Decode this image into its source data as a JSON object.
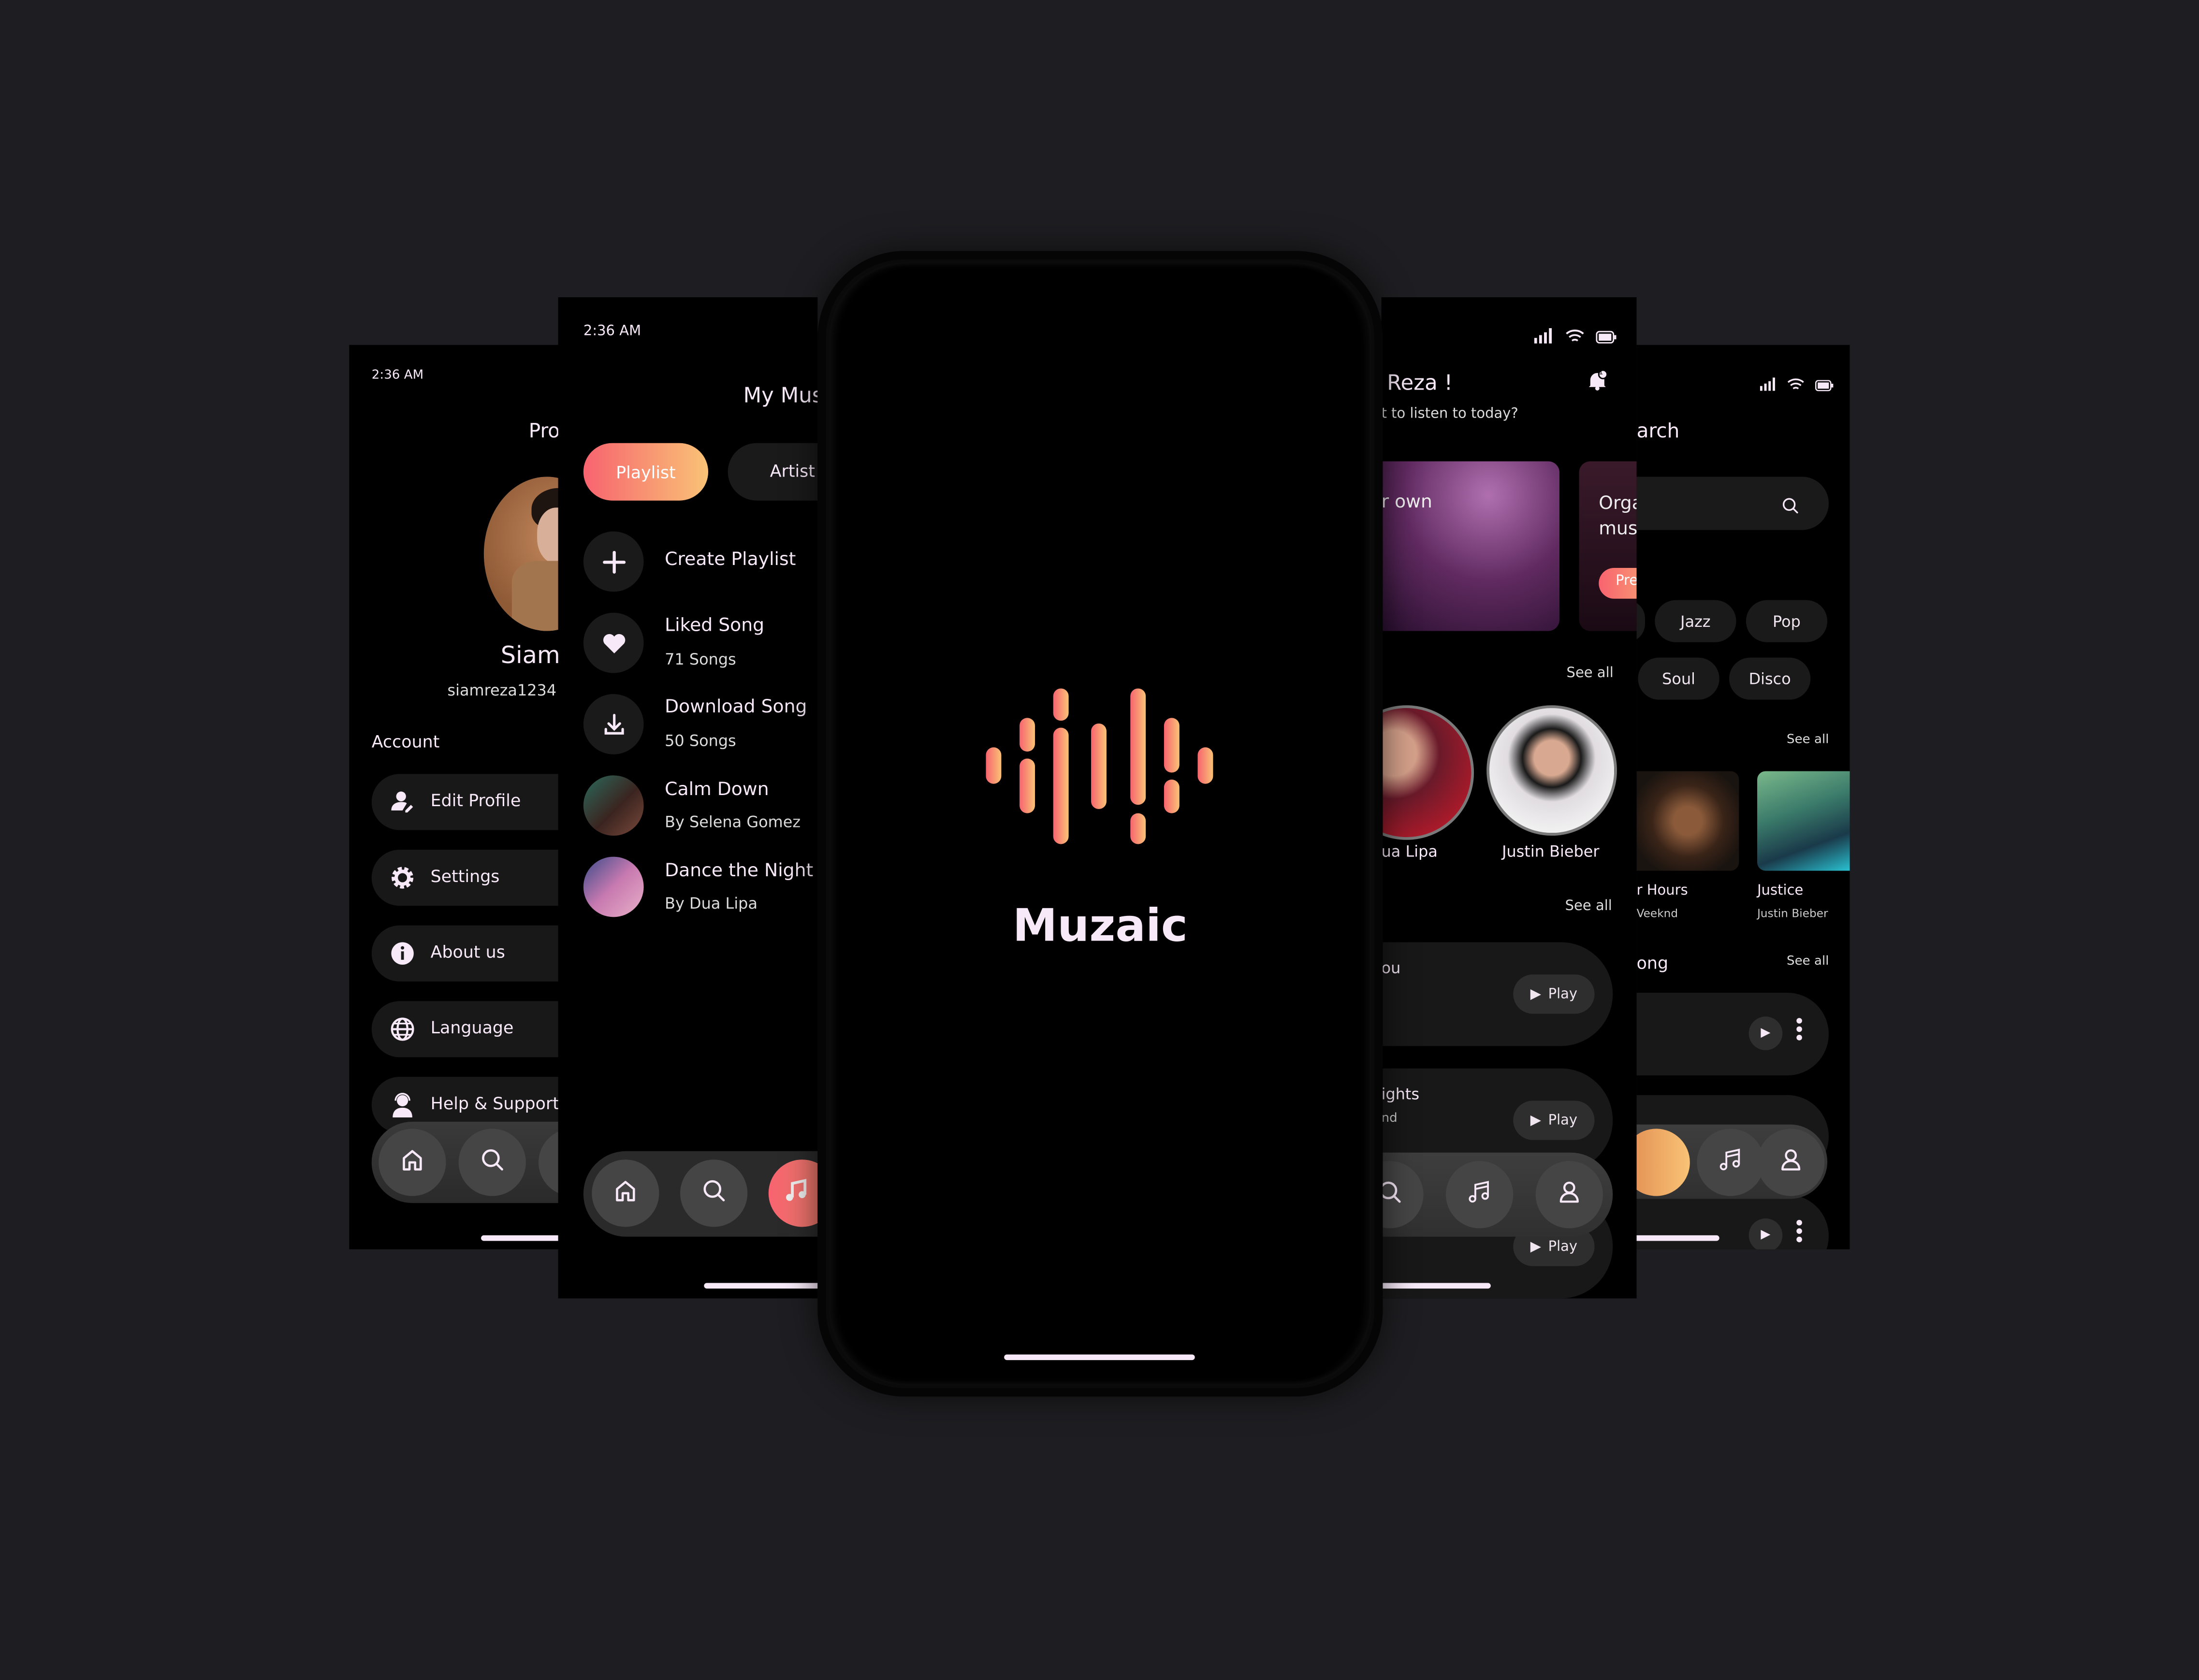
{
  "brand": {
    "app_name": "Muzaic",
    "gradient_start": "#f8636f",
    "gradient_end": "#f9c376",
    "background": "#1e1e22"
  },
  "profile_screen": {
    "status_time": "2:36 AM",
    "title": "Pro",
    "user_name": "Siam",
    "user_handle": "siamreza1234!",
    "section_label": "Account",
    "menu": [
      {
        "icon": "edit-user-icon",
        "label": "Edit Profile"
      },
      {
        "icon": "gear-icon",
        "label": "Settings"
      },
      {
        "icon": "info-icon",
        "label": "About us"
      },
      {
        "icon": "globe-icon",
        "label": "Language"
      },
      {
        "icon": "support-agent-icon",
        "label": "Help & Support"
      }
    ],
    "nav": [
      "home-icon",
      "search-icon"
    ]
  },
  "music_screen": {
    "status_time": "2:36 AM",
    "title": "My Mus",
    "tabs": [
      {
        "label": "Playlist",
        "active": true
      },
      {
        "label": "Artist",
        "active": false
      }
    ],
    "items": [
      {
        "icon": "plus-icon",
        "title": "Create Playlist",
        "subtitle": ""
      },
      {
        "icon": "heart-icon",
        "title": "Liked Song",
        "subtitle": "71 Songs"
      },
      {
        "icon": "download-icon",
        "title": "Download Song",
        "subtitle": "50 Songs"
      },
      {
        "icon": "album-art",
        "title": "Calm Down",
        "subtitle": "By Selena Gomez"
      },
      {
        "icon": "album-art",
        "title": "Dance the Night",
        "subtitle": "By Dua Lipa"
      }
    ],
    "nav": [
      "home-icon",
      "search-icon",
      "music-note-icon"
    ]
  },
  "splash_screen": {
    "logo_text": "Muzaic"
  },
  "home_screen": {
    "greeting": "Reza !",
    "subtitle": "t to listen to today?",
    "notification_count": "1",
    "banners": [
      {
        "text": "r own"
      },
      {
        "text": "Orga mus",
        "button": "Pre"
      }
    ],
    "artists_see_all": "See all",
    "artists": [
      {
        "name": "ua Lipa"
      },
      {
        "name": "Justin Bieber"
      }
    ],
    "songs_see_all": "See all",
    "songs": [
      {
        "title": "ou",
        "artist": "",
        "action": "Play"
      },
      {
        "title": "ights",
        "artist": "nd",
        "action": "Play"
      },
      {
        "title": "",
        "artist": "",
        "action": "Play"
      }
    ],
    "nav": [
      "search-icon",
      "music-note-icon",
      "user-icon"
    ]
  },
  "search_screen": {
    "title": "arch",
    "search_placeholder": "",
    "genres": [
      "Jazz",
      "Pop",
      "Soul",
      "Disco"
    ],
    "albums_see_all": "See all",
    "albums": [
      {
        "title": "r Hours",
        "artist": "Veeknd"
      },
      {
        "title": "Justice",
        "artist": "Justin Bieber"
      }
    ],
    "songs_label": "ong",
    "songs_see_all": "See all",
    "nav": [
      "music-note-icon",
      "user-icon"
    ]
  }
}
